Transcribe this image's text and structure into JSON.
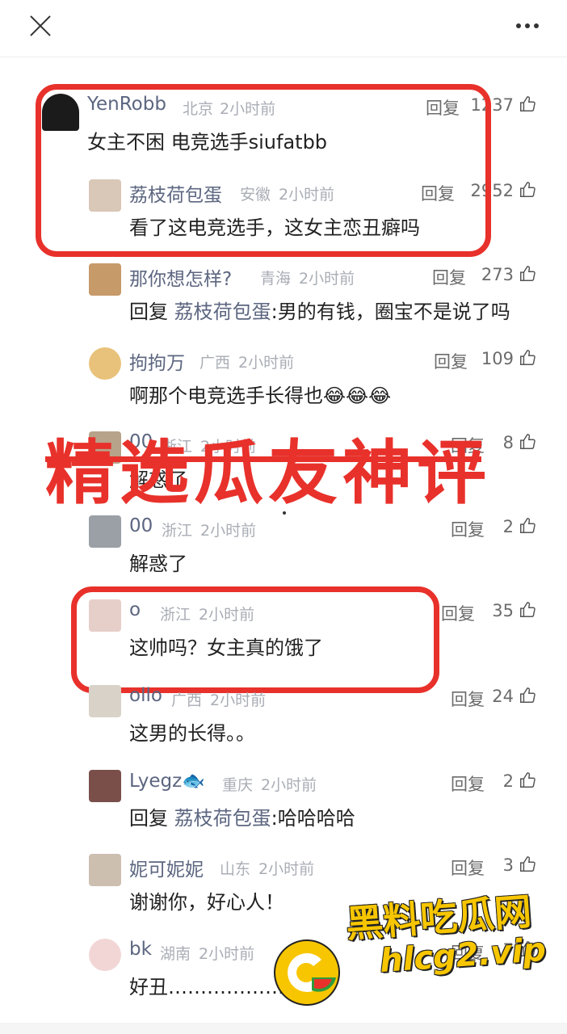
{
  "header": {
    "close_icon": "close-icon",
    "more_icon": "more-horizontal-icon"
  },
  "banner_text": "精选瓜友神评",
  "comments": [
    {
      "id": "c1",
      "name": "YenRobb",
      "location": "北京",
      "time": "2小时前",
      "reply_label": "回复",
      "likes": "1237",
      "text": "女主不困  电竞选手siufatbb",
      "avatar_color": "#1b1b1b"
    },
    {
      "id": "c2",
      "name": "荔枝荷包蛋",
      "location": "安徽",
      "time": "2小时前",
      "reply_label": "回复",
      "likes": "2952",
      "text": "看了这电竞选手，这女主恋丑癖吗",
      "avatar_color": "#d9c7b8"
    },
    {
      "id": "c3",
      "name": "那你想怎样?",
      "location": "青海",
      "time": "2小时前",
      "reply_label": "回复",
      "likes": "273",
      "text_prefix": "回复 ",
      "text_name": "荔枝荷包蛋",
      "text": ":男的有钱，圈宝不是说了吗",
      "avatar_color": "#c79a6a"
    },
    {
      "id": "c4",
      "name": "拘拘万",
      "location": "广西",
      "time": "2小时前",
      "reply_label": "回复",
      "likes": "109",
      "text": "啊那个电竞选手长得也😂😂😂",
      "avatar_color": "#e8c27a"
    },
    {
      "id": "c5",
      "name": "00",
      "location": "浙江",
      "time": "2小时前",
      "reply_label": "回复",
      "likes": "8",
      "text": "解惑了",
      "avatar_color": "#b7a38a"
    },
    {
      "id": "c6",
      "name": "00",
      "location": "浙江",
      "time": "2小时前",
      "reply_label": "回复",
      "likes": "2",
      "text": "解惑了",
      "avatar_color": "#9aa0a6"
    },
    {
      "id": "c7",
      "name": "o",
      "location": "浙江",
      "time": "2小时前",
      "reply_label": "回复",
      "likes": "35",
      "text": "这帅吗？女主真的饿了",
      "avatar_color": "#e7cfc9"
    },
    {
      "id": "c8",
      "name": "ollo",
      "location": "广西",
      "time": "2小时前",
      "reply_label": "回复",
      "likes": "24",
      "text": "这男的长得。。",
      "avatar_color": "#d8d2c8"
    },
    {
      "id": "c9",
      "name": "Lyegz🐟",
      "location": "重庆",
      "time": "2小时前",
      "reply_label": "回复",
      "likes": "2",
      "text_prefix": "回复 ",
      "text_name": "荔枝荷包蛋",
      "text": ":哈哈哈哈",
      "avatar_color": "#7a4f4a"
    },
    {
      "id": "c10",
      "name": "妮可妮妮",
      "location": "山东",
      "time": "2小时前",
      "reply_label": "回复",
      "likes": "3",
      "text": "谢谢你，好心人！",
      "avatar_color": "#cdbfb0"
    },
    {
      "id": "c11",
      "name": "bk",
      "location": "湖南",
      "time": "2小时前",
      "reply_label": "回复",
      "likes": "7",
      "text": "好丑………………",
      "avatar_color": "#f2d6d6"
    }
  ],
  "watermark": {
    "title": "黑料吃瓜网",
    "url": "hlcg2.vip"
  },
  "colors": {
    "highlight": "#e8312b",
    "username": "#5c6680",
    "meta": "#a9adb5",
    "watermark": "#f7c600"
  }
}
